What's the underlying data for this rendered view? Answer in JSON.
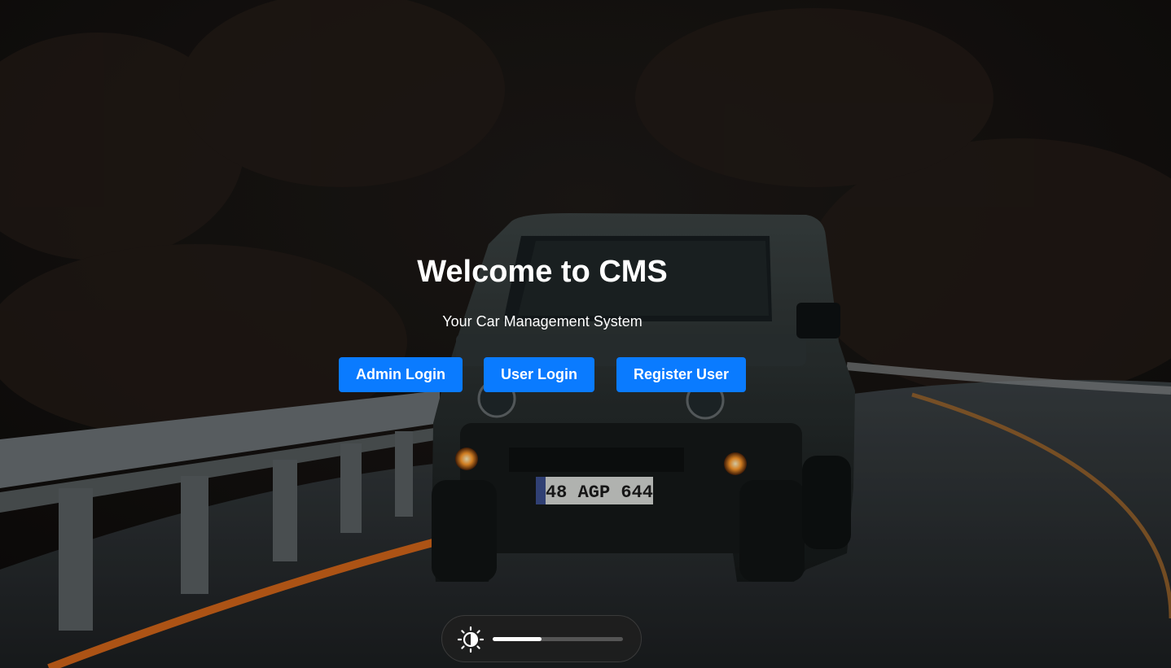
{
  "hero": {
    "title": "Welcome to CMS",
    "subtitle": "Your Car Management System"
  },
  "buttons": {
    "admin_login": "Admin Login",
    "user_login": "User Login",
    "register_user": "Register User"
  },
  "background": {
    "license_plate": "48 AGP 644"
  },
  "brightness": {
    "icon": "brightness-icon",
    "level": 0.375
  },
  "colors": {
    "button": "#0a7bff",
    "text": "#ffffff"
  }
}
